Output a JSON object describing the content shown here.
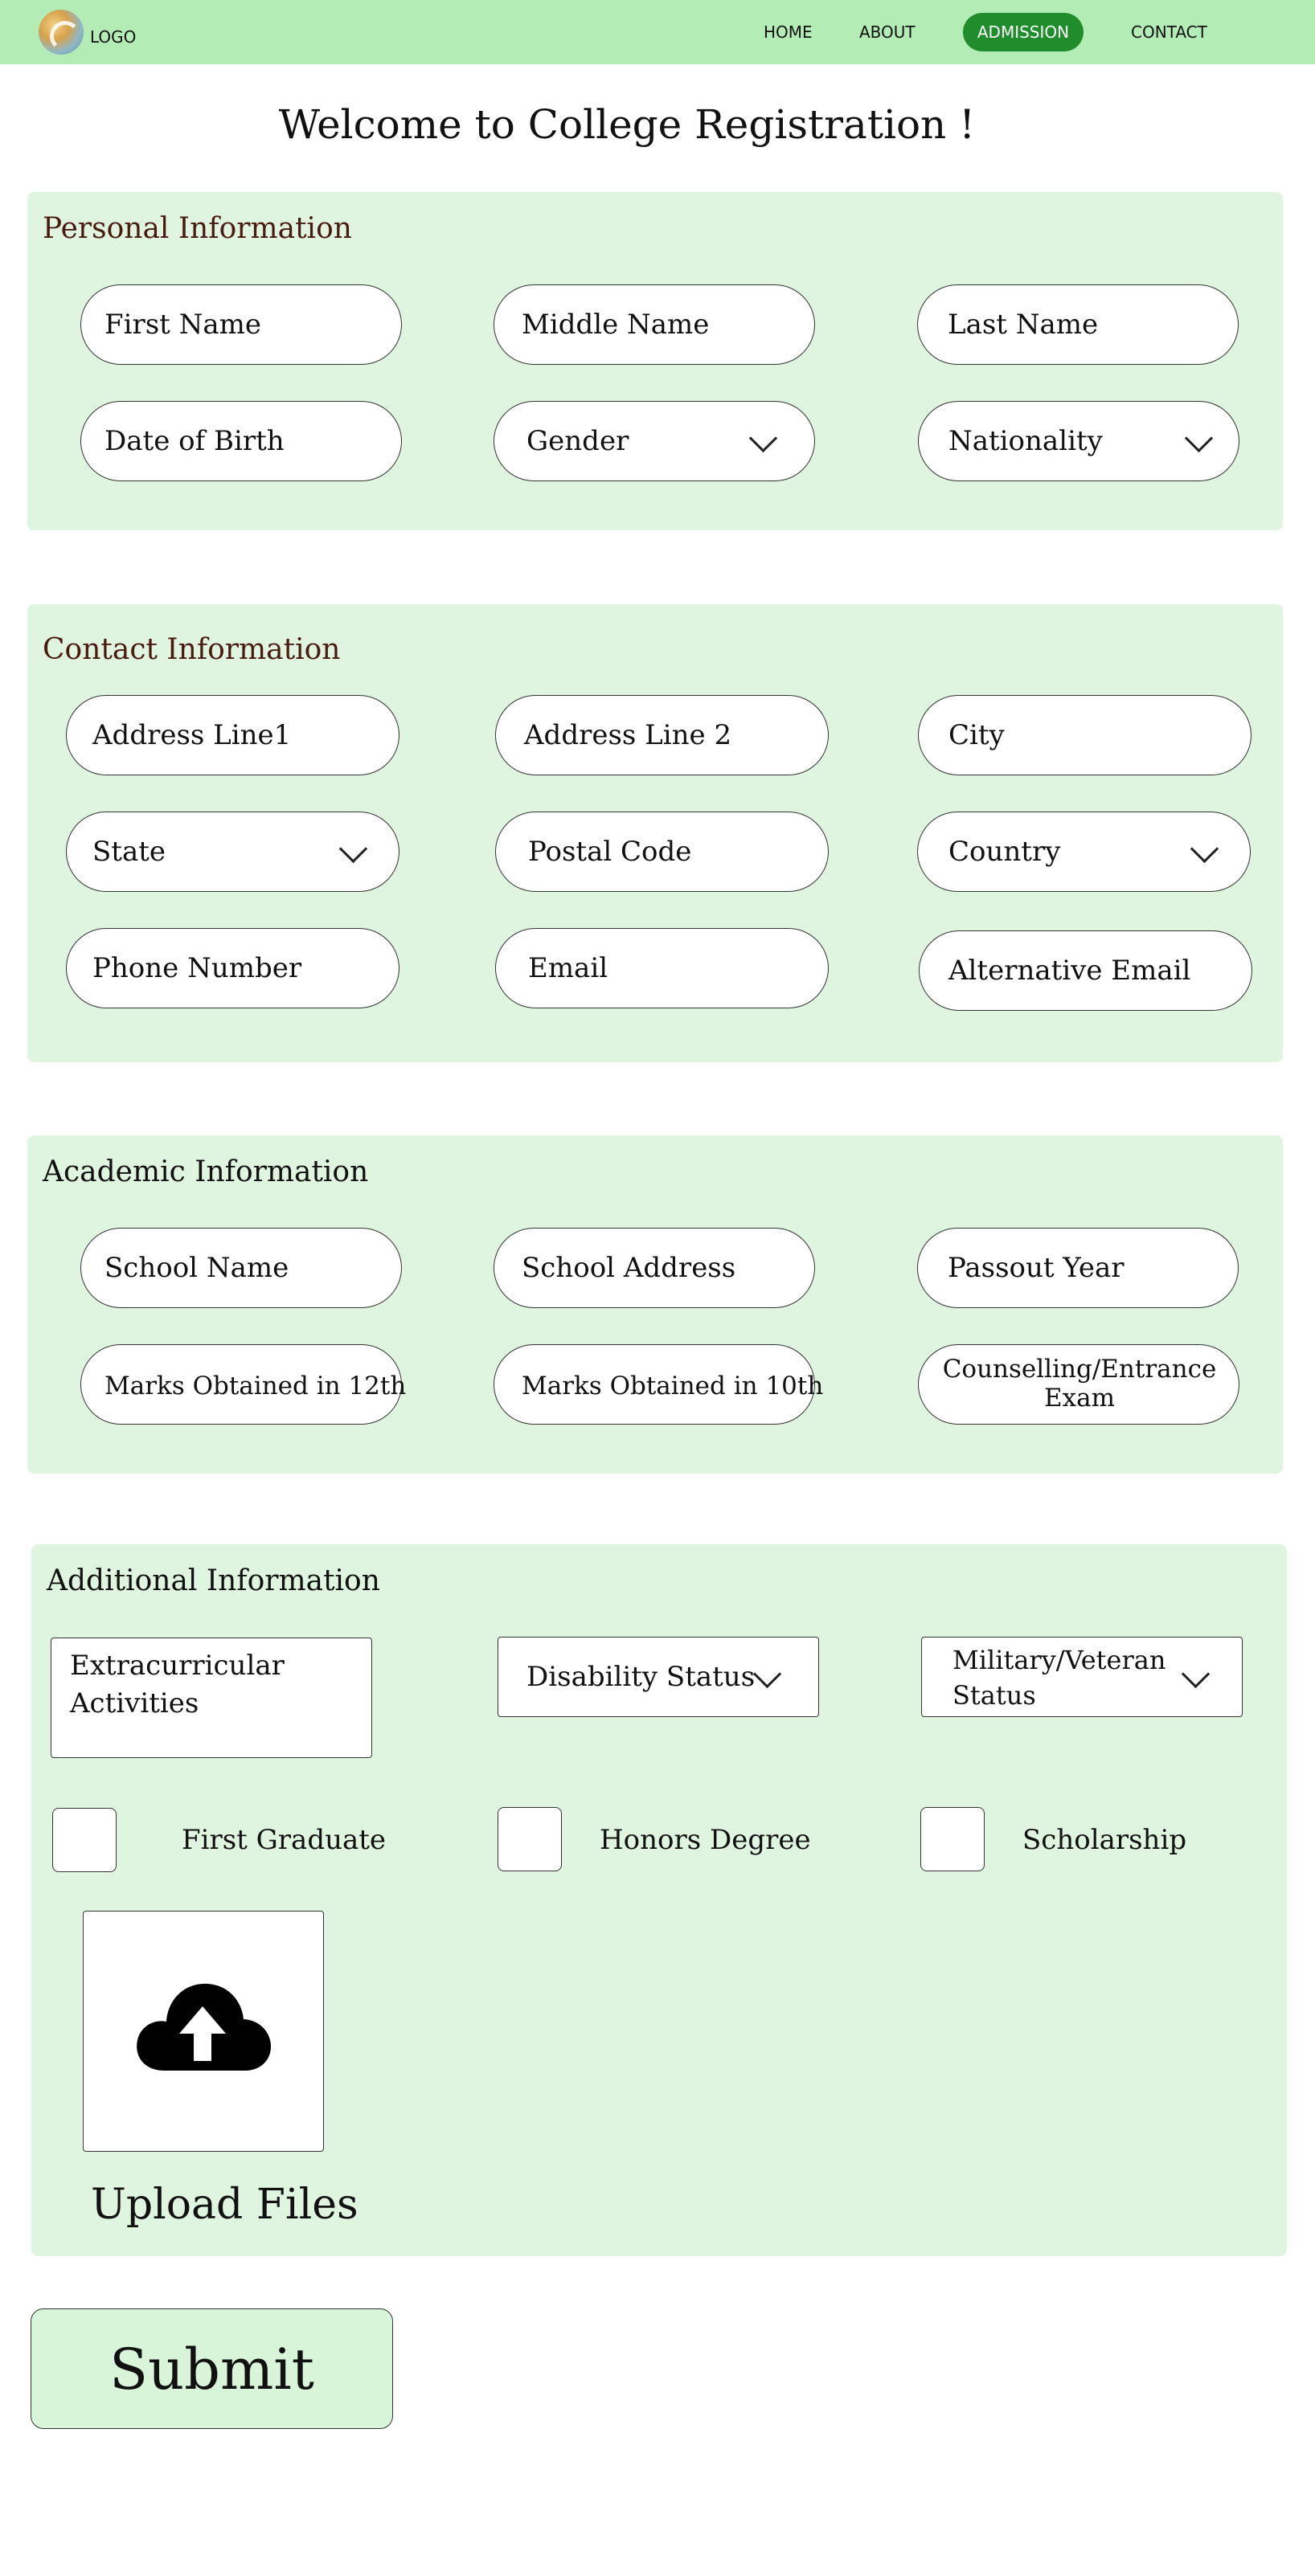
{
  "nav": {
    "logo": "LOGO",
    "items": [
      {
        "label": "HOME",
        "active": false
      },
      {
        "label": "ABOUT",
        "active": false
      },
      {
        "label": "ADMISSION",
        "active": true
      },
      {
        "label": "CONTACT",
        "active": false
      }
    ]
  },
  "page_title": "Welcome to College Registration !",
  "personal": {
    "title": "Personal Information",
    "fields": {
      "first_name": "First Name",
      "middle_name": "Middle Name",
      "last_name": "Last Name",
      "dob": "Date of Birth",
      "gender": "Gender",
      "nationality": "Nationality"
    }
  },
  "contact": {
    "title": "Contact Information",
    "fields": {
      "address1": "Address Line1",
      "address2": "Address Line 2",
      "city": "City",
      "state": "State",
      "postal": "Postal Code",
      "country": "Country",
      "phone": "Phone Number",
      "email": "Email",
      "alt_email": "Alternative Email"
    }
  },
  "academic": {
    "title": "Academic Information",
    "fields": {
      "school_name": "School Name",
      "school_address": "School Address",
      "passout_year": "Passout Year",
      "marks_12": "Marks Obtained in 12th",
      "marks_10": "Marks Obtained in 10th",
      "counselling_line1": "Counselling/Entrance",
      "counselling_line2": "Exam"
    }
  },
  "additional": {
    "title": "Additional Information",
    "fields": {
      "extracurricular_line1": "Extracurricular",
      "extracurricular_line2": "Activities",
      "disability": "Disability Status",
      "military_line1": "Military/Veteran",
      "military_line2": "Status"
    },
    "checkboxes": {
      "first_graduate": "First Graduate",
      "honors_degree": "Honors Degree",
      "scholarship": "Scholarship"
    },
    "upload_label": "Upload Files"
  },
  "submit_label": "Submit",
  "colors": {
    "navbar": "#b3ecb5",
    "nav_active": "#1f8d2c",
    "section_bg": "#dff5df",
    "section_title_dark_red": "#4a1a10",
    "submit_bg": "#d9f5d9"
  },
  "icons": [
    "logo-icon",
    "chevron-down-icon",
    "cloud-upload-icon"
  ]
}
